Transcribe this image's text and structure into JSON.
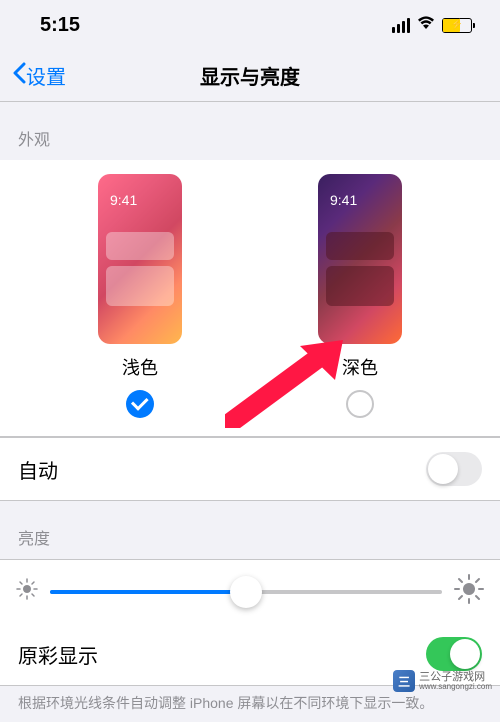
{
  "status": {
    "time": "5:15"
  },
  "nav": {
    "back_label": "设置",
    "title": "显示与亮度"
  },
  "appearance": {
    "header": "外观",
    "preview_time": "9:41",
    "light_label": "浅色",
    "dark_label": "深色",
    "selected": "light"
  },
  "auto": {
    "label": "自动",
    "enabled": false
  },
  "brightness": {
    "header": "亮度",
    "value_pct": 50
  },
  "true_tone": {
    "label": "原彩显示",
    "enabled": true
  },
  "footer": {
    "text": "根据环境光线条件自动调整 iPhone 屏幕以在不同环境下显示一致。"
  },
  "watermark": {
    "name": "三公子游戏网",
    "url": "www.sangongzi.com"
  }
}
